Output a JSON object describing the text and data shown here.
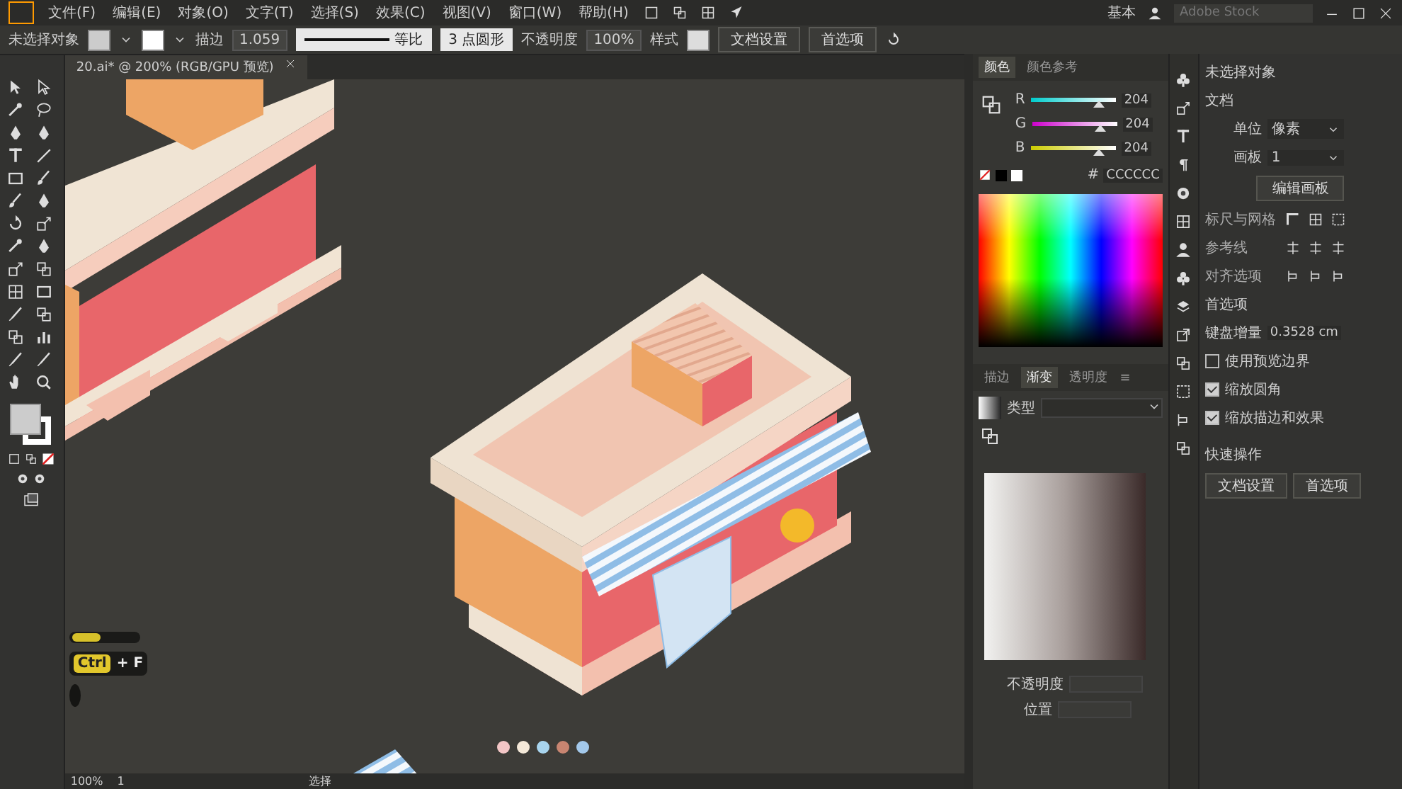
{
  "menu_bar": {
    "items": [
      "文件(F)",
      "编辑(E)",
      "对象(O)",
      "文字(T)",
      "选择(S)",
      "效果(C)",
      "视图(V)",
      "窗口(W)",
      "帮助(H)"
    ]
  },
  "workspace": "基本",
  "stock_search": {
    "placeholder": "Adobe Stock"
  },
  "control_bar": {
    "selection": "未选择对象",
    "stroke_label": "描边",
    "stroke_weight": "1.059",
    "profile": "等比",
    "brush": "3 点圆形",
    "opacity_label": "不透明度",
    "opacity": "100%",
    "style_label": "样式",
    "buttons": [
      "文档设置",
      "首选项"
    ]
  },
  "document_tab": {
    "title": "20.ai* @ 200% (RGB/GPU 预览)"
  },
  "color_panel": {
    "tabs": [
      {
        "label": "颜色",
        "selected": true
      },
      {
        "label": "颜色参考",
        "selected": false
      }
    ],
    "sliders": [
      {
        "label": "R",
        "level": 0.8,
        "value": "204"
      },
      {
        "label": "G",
        "level": 0.8,
        "value": "204"
      },
      {
        "label": "B",
        "level": 0.8,
        "value": "204"
      }
    ],
    "hex_prefix": "#",
    "hex": "CCCCCC"
  },
  "gradient_panel": {
    "tabs": [
      {
        "label": "描边",
        "selected": false
      },
      {
        "label": "渐变",
        "selected": true
      },
      {
        "label": "透明度",
        "selected": false
      }
    ],
    "type_label": "类型",
    "opacity_label": "不透明度",
    "location_label": "位置"
  },
  "properties_panel": {
    "title": "未选择对象",
    "document_heading": "文档",
    "units_label": "单位",
    "units": "像素",
    "artboard_label": "画板",
    "artboard": "1",
    "edit_artboards": "编辑画板",
    "rulers_grids": "标尺与网格",
    "guides": "参考线",
    "snap_options": "对齐选项",
    "preferences_heading": "首选项",
    "keyboard_increment_label": "键盘增量",
    "keyboard_increment": "0.3528 cm",
    "checkboxes": [
      {
        "label": "使用预览边界",
        "checked": false
      },
      {
        "label": "缩放圆角",
        "checked": true
      },
      {
        "label": "缩放描边和效果",
        "checked": true
      }
    ],
    "quick_actions": "快速操作",
    "buttons": [
      "文档设置",
      "首选项"
    ]
  },
  "shortcut_overlay": {
    "keys": [
      {
        "kind": "key",
        "label": "Ctrl"
      },
      {
        "kind": "text",
        "label": "+ F"
      }
    ]
  },
  "color_dots": [
    {
      "color": "#f3c6c6"
    },
    {
      "color": "#f4e8d8"
    },
    {
      "color": "#a8d4ee"
    },
    {
      "color": "#c88571"
    },
    {
      "color": "#a3c8ea"
    }
  ],
  "status_bar": {
    "zoom": "100%",
    "artboard": "1",
    "tool": "选择"
  }
}
